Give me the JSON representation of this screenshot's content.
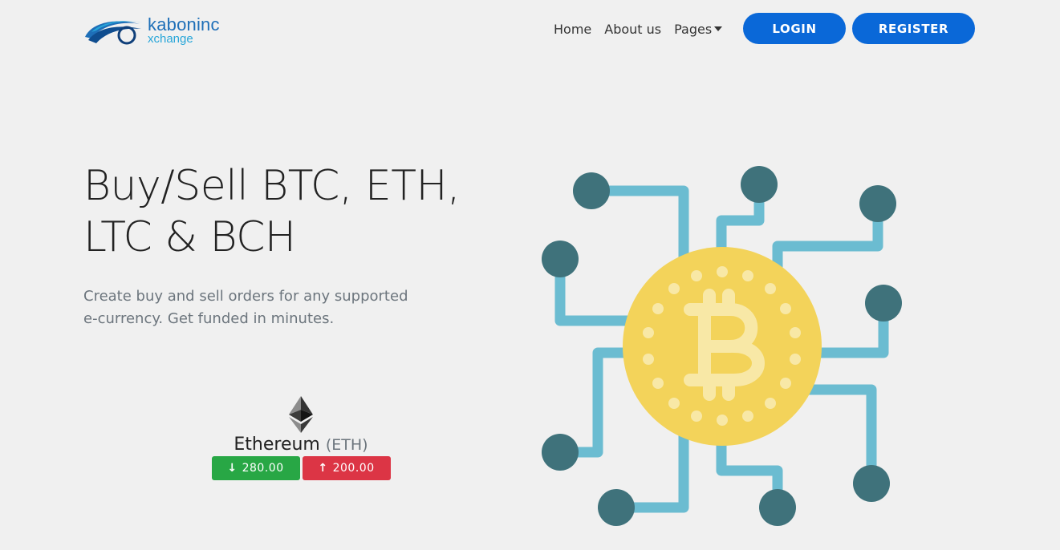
{
  "brand": {
    "name_top": "kaboninc",
    "name_bottom": "xchange",
    "colors": {
      "primary": "#1e6fb8",
      "secondary": "#27a6d9"
    }
  },
  "nav": {
    "items": [
      {
        "label": "Home"
      },
      {
        "label": "About us"
      },
      {
        "label": "Pages"
      }
    ],
    "login_label": "LOGIN",
    "register_label": "REGISTER",
    "button_color": "#0a68d8"
  },
  "hero": {
    "title_line1": "Buy/Sell BTC, ETH,",
    "title_line2": "LTC & BCH",
    "subtitle_line1": "Create buy and sell orders for any supported",
    "subtitle_line2": "e-currency. Get funded in minutes."
  },
  "currency_card": {
    "name": "Ethereum",
    "symbol": "(ETH)",
    "sell_rate": "280.00",
    "buy_rate": "200.00",
    "sell_icon": "arrow-down-icon",
    "buy_icon": "arrow-up-icon",
    "sell_color": "#28a745",
    "buy_color": "#dc3545"
  },
  "illustration": {
    "icon": "bitcoin-circuit-icon",
    "coin_color": "#f3d35a",
    "circuit_color": "#6bbcd1",
    "node_color": "#3f727b"
  }
}
